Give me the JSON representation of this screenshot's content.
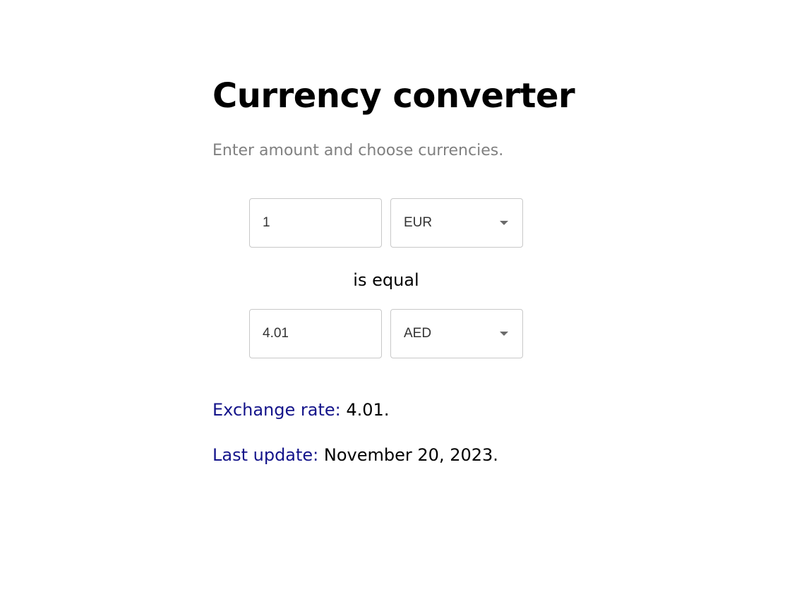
{
  "header": {
    "title": "Currency converter",
    "subtitle": "Enter amount and choose currencies."
  },
  "from": {
    "amount": "1",
    "currency": "EUR"
  },
  "equal_text": "is equal",
  "to": {
    "amount": "4.01",
    "currency": "AED"
  },
  "info": {
    "rate_label": "Exchange rate:",
    "rate_value": "4.01.",
    "update_label": "Last update:",
    "update_value": "November 20, 2023."
  },
  "colors": {
    "label": "#14148a",
    "subtitle": "#808080",
    "border": "#c8c8c8"
  }
}
